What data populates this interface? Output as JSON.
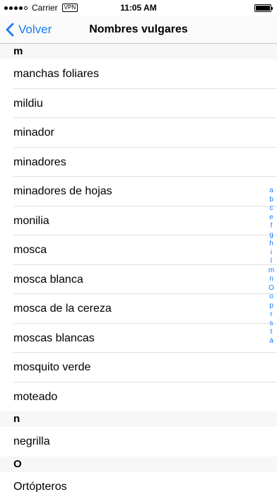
{
  "status_bar": {
    "carrier": "Carrier",
    "network": "VPN",
    "time": "11:05 AM"
  },
  "nav": {
    "back_label": "Volver",
    "title": "Nombres vulgares"
  },
  "sections": [
    {
      "header": "m",
      "items": [
        "manchas foliares",
        "mildiu",
        "minador",
        "minadores",
        "minadores de hojas",
        "monilia",
        "mosca",
        "mosca blanca",
        "mosca de la cereza",
        "moscas blancas",
        "mosquito verde",
        "moteado"
      ]
    },
    {
      "header": "n",
      "items": [
        "negrilla"
      ]
    },
    {
      "header": "O",
      "items": [
        "Ortópteros"
      ]
    }
  ],
  "index_letters": [
    "a",
    "b",
    "c",
    "e",
    "f",
    "g",
    "h",
    "i",
    "l",
    "m",
    "n",
    "O",
    "o",
    "p",
    "r",
    "s",
    "t",
    "á"
  ],
  "colors": {
    "accent": "#1a7cf6",
    "section_bg": "#f7f7f7",
    "separator": "#e0e0e0"
  }
}
